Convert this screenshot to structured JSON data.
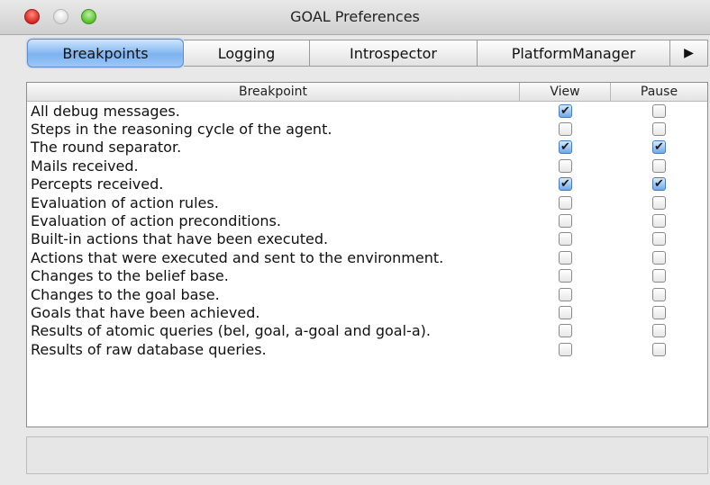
{
  "window": {
    "title": "GOAL Preferences"
  },
  "tabs": [
    {
      "label": "Breakpoints",
      "active": true
    },
    {
      "label": "Logging",
      "active": false
    },
    {
      "label": "Introspector",
      "active": false
    },
    {
      "label": "PlatformManager",
      "active": false
    }
  ],
  "tab_scroll_icon": "right-triangle-icon",
  "table": {
    "headers": [
      "Breakpoint",
      "View",
      "Pause"
    ],
    "rows": [
      {
        "label": "All debug messages.",
        "view": true,
        "pause": false
      },
      {
        "label": "Steps in the reasoning cycle of the agent.",
        "view": false,
        "pause": false
      },
      {
        "label": "The round separator.",
        "view": true,
        "pause": true
      },
      {
        "label": "Mails received.",
        "view": false,
        "pause": false
      },
      {
        "label": "Percepts received.",
        "view": true,
        "pause": true
      },
      {
        "label": "Evaluation of action rules.",
        "view": false,
        "pause": false
      },
      {
        "label": "Evaluation of action preconditions.",
        "view": false,
        "pause": false
      },
      {
        "label": "Built-in actions that have been executed.",
        "view": false,
        "pause": false
      },
      {
        "label": "Actions that were executed and sent to the environment.",
        "view": false,
        "pause": false
      },
      {
        "label": "Changes to the belief base.",
        "view": false,
        "pause": false
      },
      {
        "label": "Changes to the goal base.",
        "view": false,
        "pause": false
      },
      {
        "label": "Goals that have been achieved.",
        "view": false,
        "pause": false
      },
      {
        "label": "Results of atomic queries (bel, goal, a-goal and goal-a).",
        "view": false,
        "pause": false
      },
      {
        "label": "Results of raw database queries.",
        "view": false,
        "pause": false
      }
    ]
  },
  "colors": {
    "accent": "#5d8ed0",
    "close": "#d6261e",
    "maximize": "#58c12a"
  }
}
